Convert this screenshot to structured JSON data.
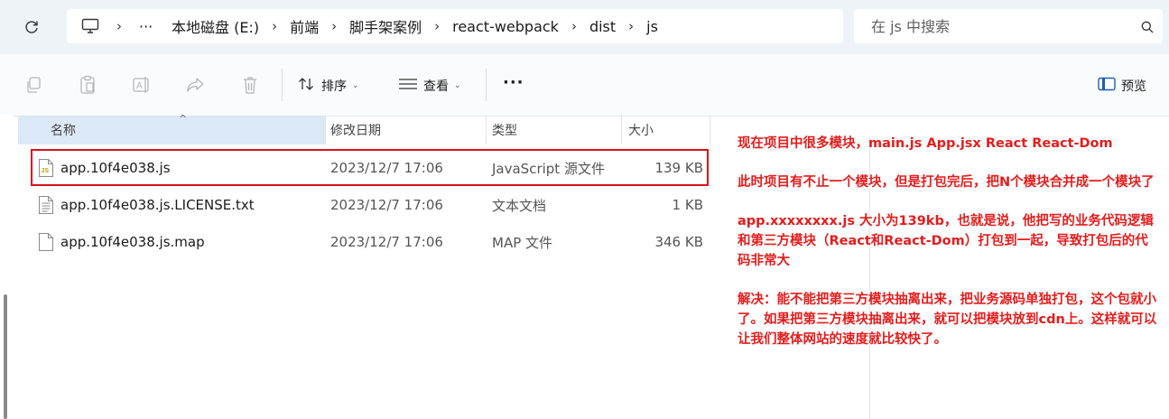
{
  "address_bar": {
    "breadcrumbs": [
      "本地磁盘 (E:)",
      "前端",
      "脚手架案例",
      "react-webpack",
      "dist",
      "js"
    ],
    "more_label": "···"
  },
  "search": {
    "placeholder": "在 js 中搜索"
  },
  "toolbar": {
    "sort_label": "排序",
    "view_label": "查看",
    "more_label": "···",
    "preview_label": "预览"
  },
  "columns": {
    "name": "名称",
    "date": "修改日期",
    "type": "类型",
    "size": "大小"
  },
  "files": [
    {
      "name": "app.10f4e038.js",
      "date": "2023/12/7 17:06",
      "type": "JavaScript 源文件",
      "size": "139 KB",
      "icon": "js-file-icon"
    },
    {
      "name": "app.10f4e038.js.LICENSE.txt",
      "date": "2023/12/7 17:06",
      "type": "文本文档",
      "size": "1 KB",
      "icon": "text-file-icon"
    },
    {
      "name": "app.10f4e038.js.map",
      "date": "2023/12/7 17:06",
      "type": "MAP 文件",
      "size": "346 KB",
      "icon": "blank-file-icon"
    }
  ],
  "annotation": {
    "color": "#e51c1c",
    "paragraphs": [
      "现在项目中很多模块，main.js  App.jsx  React React-Dom",
      "此时项目有不止一个模块，但是打包完后，把N个模块合并成一个模块了",
      "app.xxxxxxxx.js 大小为139kb，也就是说，他把写的业务代码逻辑和第三方模块（React和React-Dom）打包到一起，导致打包后的代码非常大",
      "解决：能不能把第三方模块抽离出来，把业务源码单独打包，这个包就小了。如果把第三方模块抽离出来，就可以把模块放到cdn上。这样就可以让我们整体网站的速度就比较快了。"
    ]
  }
}
